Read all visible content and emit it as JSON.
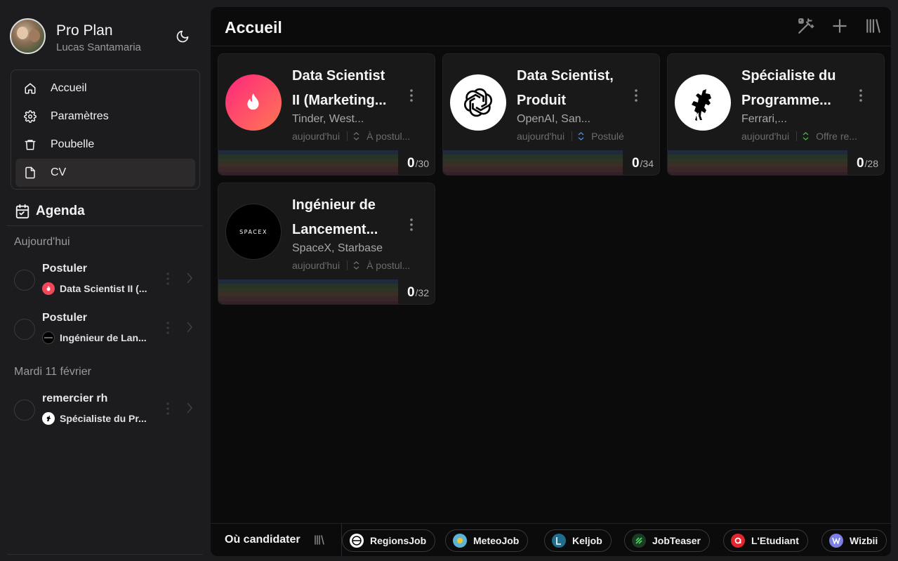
{
  "profile": {
    "plan": "Pro Plan",
    "user": "Lucas Santamaria"
  },
  "nav": [
    {
      "label": "Accueil",
      "icon": "home-icon"
    },
    {
      "label": "Paramètres",
      "icon": "gear-icon"
    },
    {
      "label": "Poubelle",
      "icon": "trash-icon"
    },
    {
      "label": "CV",
      "icon": "document-icon",
      "active": true
    }
  ],
  "agenda": {
    "title": "Agenda",
    "groups": [
      {
        "day": "Aujourd'hui",
        "tasks": [
          {
            "title": "Postuler",
            "job": "Data Scientist II (...",
            "logo_color": "#f0485a"
          },
          {
            "title": "Postuler",
            "job": "Ingénieur de Lan...",
            "logo_color": "#000000"
          }
        ]
      },
      {
        "day": "Mardi 11 février",
        "tasks": [
          {
            "title": "remercier rh",
            "job": "Spécialiste du Pr...",
            "logo_color": "#ffffff"
          }
        ]
      }
    ]
  },
  "main": {
    "title": "Accueil",
    "cards": [
      {
        "title_line1": "Data Scientist",
        "title_line2": "II (Marketing...",
        "company": "Tinder, West...",
        "date": "aujourd'hui",
        "status": "À postul...",
        "status_color": "#6c6c6c",
        "score": "0",
        "total": "/30",
        "logo": "tinder"
      },
      {
        "title_line1": "Data Scientist,",
        "title_line2": "Produit",
        "company": "OpenAI, San...",
        "date": "aujourd'hui",
        "status": "Postulé",
        "status_color": "#4a90d9",
        "score": "0",
        "total": "/34",
        "logo": "openai"
      },
      {
        "title_line1": "Spécialiste du",
        "title_line2": "Programme...",
        "company": "Ferrari,...",
        "date": "aujourd'hui",
        "status": "Offre re...",
        "status_color": "#4caf50",
        "score": "0",
        "total": "/28",
        "logo": "ferrari"
      },
      {
        "title_line1": "Ingénieur de",
        "title_line2": "Lancement...",
        "company": "SpaceX, Starbase",
        "date": "aujourd'hui",
        "status": "À postul...",
        "status_color": "#6c6c6c",
        "score": "0",
        "total": "/32",
        "logo": "spacex"
      }
    ],
    "spacex_wordmark": "SPACEX"
  },
  "footer": {
    "label": "Où candidater",
    "sites": [
      {
        "name": "RegionsJob",
        "color": "#ffffff"
      },
      {
        "name": "MeteoJob",
        "color": "#5bb3d6"
      },
      {
        "name": "Keljob",
        "color": "#1e6e8c"
      },
      {
        "name": "JobTeaser",
        "color": "#2a7a3a"
      },
      {
        "name": "L'Etudiant",
        "color": "#e2262e"
      },
      {
        "name": "Wizbii",
        "color": "#7b7fe6"
      }
    ]
  }
}
